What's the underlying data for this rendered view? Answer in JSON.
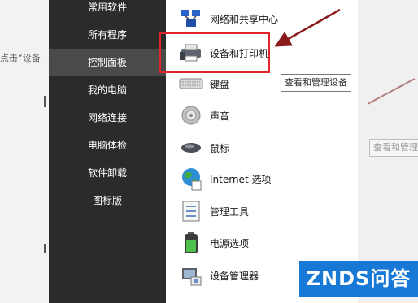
{
  "background": {
    "left_text": "点击“设备",
    "right_tooltip": "查看和管理"
  },
  "start_menu": {
    "items": [
      {
        "label": "常用软件"
      },
      {
        "label": "所有程序"
      },
      {
        "label": "控制面板",
        "active": true
      },
      {
        "label": "我的电脑"
      },
      {
        "label": "网络连接"
      },
      {
        "label": "电脑体检"
      },
      {
        "label": "软件卸载"
      },
      {
        "label": "图标版"
      }
    ]
  },
  "control_panel": {
    "items": [
      {
        "label": "网络和共享中心",
        "icon": "network-icon"
      },
      {
        "label": "设备和打印机",
        "icon": "printer-icon",
        "highlighted": true
      },
      {
        "label": "键盘",
        "icon": "keyboard-icon"
      },
      {
        "label": "声音",
        "icon": "speaker-icon"
      },
      {
        "label": "鼠标",
        "icon": "mouse-icon"
      },
      {
        "label": "Internet 选项",
        "icon": "globe-icon"
      },
      {
        "label": "管理工具",
        "icon": "admin-tools-icon"
      },
      {
        "label": "电源选项",
        "icon": "battery-icon"
      },
      {
        "label": "设备管理器",
        "icon": "device-manager-icon"
      }
    ]
  },
  "tooltip": {
    "text": "查看和管理设备"
  },
  "watermark": {
    "text": "ZNDS问答"
  },
  "colors": {
    "menu_bg": "#2b2b2b",
    "menu_active": "#4a4a4a",
    "highlight": "#e0262b",
    "arrow": "#8b1a1a",
    "watermark_bg": "#1778d6"
  }
}
